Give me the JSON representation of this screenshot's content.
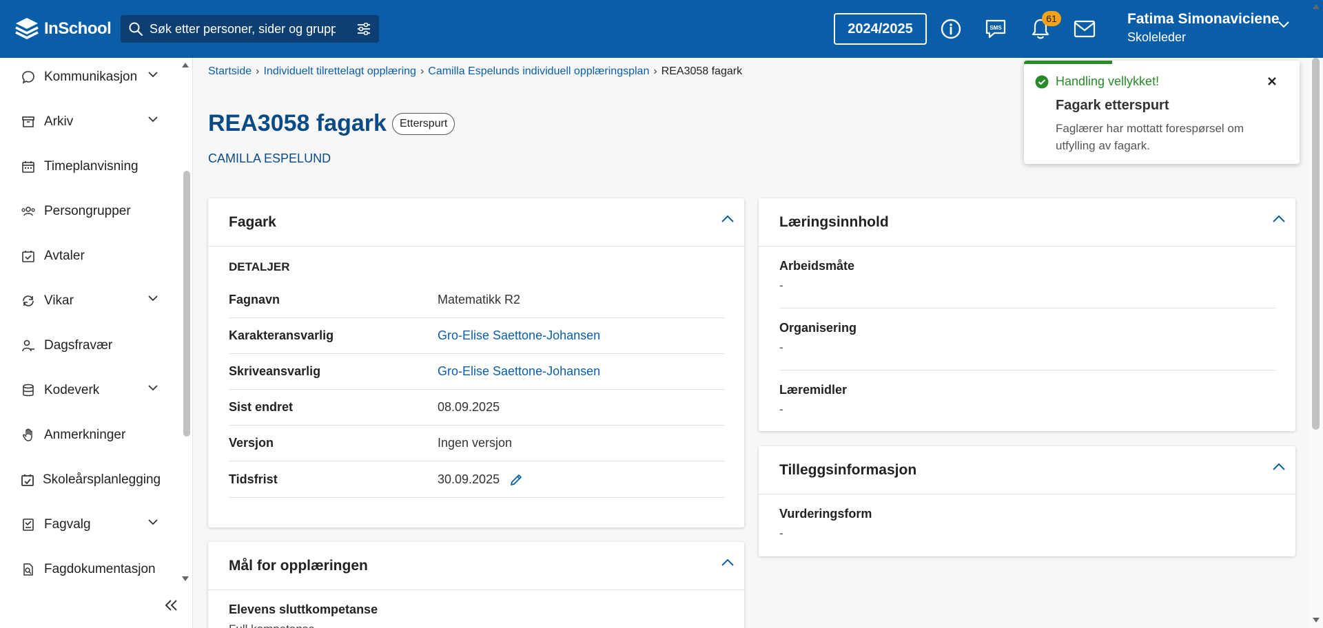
{
  "app": {
    "logo_text": "InSchool"
  },
  "search": {
    "placeholder": "Søk etter personer, sider og grupper"
  },
  "header": {
    "year_label": "2024/2025",
    "notification_count": "61",
    "user_name": "Fatima Simonaviciene",
    "user_role": "Skoleleder",
    "icons": [
      "info-icon",
      "sms-icon",
      "bell-icon",
      "mail-icon",
      "chevron-down-icon"
    ]
  },
  "sidebar": {
    "items": [
      {
        "label": "Kommunikasjon",
        "icon": "chat-icon",
        "expandable": true
      },
      {
        "label": "Arkiv",
        "icon": "archive-icon",
        "expandable": true
      },
      {
        "label": "Timeplanvisning",
        "icon": "calendar-icon",
        "expandable": false
      },
      {
        "label": "Persongrupper",
        "icon": "people-icon",
        "expandable": false
      },
      {
        "label": "Avtaler",
        "icon": "calendar-check-icon",
        "expandable": false
      },
      {
        "label": "Vikar",
        "icon": "refresh-icon",
        "expandable": true
      },
      {
        "label": "Dagsfravær",
        "icon": "person-minus-icon",
        "expandable": false
      },
      {
        "label": "Kodeverk",
        "icon": "database-icon",
        "expandable": true
      },
      {
        "label": "Anmerkninger",
        "icon": "hand-icon",
        "expandable": false
      },
      {
        "label": "Skoleårsplanlegging",
        "icon": "calendar-plan-icon",
        "expandable": false
      },
      {
        "label": "Fagvalg",
        "icon": "checklist-icon",
        "expandable": true
      },
      {
        "label": "Fagdokumentasjon",
        "icon": "document-search-icon",
        "expandable": false
      }
    ]
  },
  "breadcrumb": {
    "items": [
      "Startside",
      "Individuelt tilrettelagt opplæring",
      "Camilla Espelunds individuell opplæringsplan"
    ],
    "current": "REA3058 fagark"
  },
  "page": {
    "title": "REA3058 fagark",
    "status": "Etterspurt",
    "student": "CAMILLA ESPELUND"
  },
  "fagark": {
    "title": "Fagark",
    "section": "DETALJER",
    "rows": [
      {
        "label": "Fagnavn",
        "value": "Matematikk R2",
        "link": false
      },
      {
        "label": "Karakteransvarlig",
        "value": "Gro-Elise Saettone-Johansen",
        "link": true
      },
      {
        "label": "Skriveansvarlig",
        "value": "Gro-Elise Saettone-Johansen",
        "link": true
      },
      {
        "label": "Sist endret",
        "value": "08.09.2025",
        "link": false
      },
      {
        "label": "Versjon",
        "value": "Ingen versjon",
        "link": false
      },
      {
        "label": "Tidsfrist",
        "value": "30.09.2025",
        "link": false
      }
    ]
  },
  "maal": {
    "title": "Mål for opplæringen",
    "label": "Elevens sluttkompetanse",
    "value": "Full kompetanse"
  },
  "laering": {
    "title": "Læringsinnhold",
    "items": [
      {
        "label": "Arbeidsmåte",
        "value": "-"
      },
      {
        "label": "Organisering",
        "value": "-"
      },
      {
        "label": "Læremidler",
        "value": "-"
      }
    ]
  },
  "tillegg": {
    "title": "Tilleggsinformasjon",
    "items": [
      {
        "label": "Vurderingsform",
        "value": "-"
      }
    ]
  },
  "toast": {
    "status": "Handling vellykket!",
    "title": "Fagark etterspurt",
    "message": "Faglærer har mottatt forespørsel om utfylling av fagark."
  },
  "colors": {
    "brand": "#0a5ea8",
    "success": "#2a8a2a",
    "badge": "#f4a21b"
  }
}
